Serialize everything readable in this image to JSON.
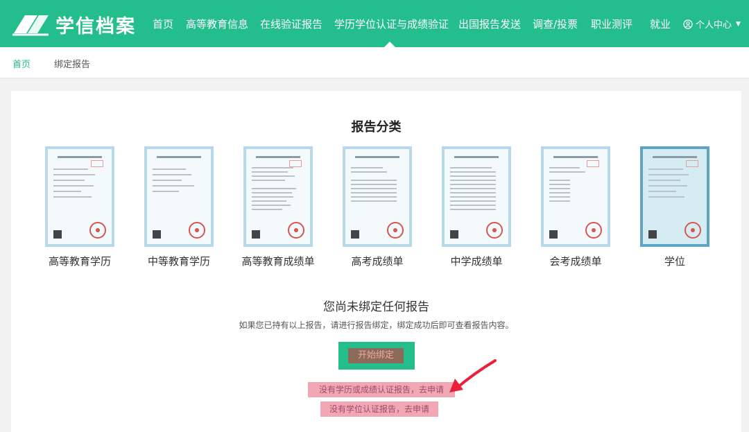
{
  "header": {
    "brand": "学信档案",
    "nav": [
      {
        "label": "首页"
      },
      {
        "label": "高等教育信息"
      },
      {
        "label": "在线验证报告"
      },
      {
        "label": "学历学位认证与成绩验证"
      },
      {
        "label": "出国报告发送"
      },
      {
        "label": "调查/投票"
      },
      {
        "label": "职业测评"
      },
      {
        "label": "就业"
      }
    ],
    "user_menu": "个人中心"
  },
  "breadcrumb": {
    "home": "首页",
    "current": "绑定报告"
  },
  "main": {
    "section_title": "报告分类",
    "reports": [
      {
        "label": "高等教育学历"
      },
      {
        "label": "中等教育学历"
      },
      {
        "label": "高等教育成绩单"
      },
      {
        "label": "高考成绩单"
      },
      {
        "label": "中学成绩单"
      },
      {
        "label": "会考成绩单"
      },
      {
        "label": "学位"
      }
    ],
    "empty_title": "您尚未绑定任何报告",
    "empty_desc": "如果您已持有以上报告，请进行报告绑定，绑定成功后即可查看报告内容。",
    "bind_button": "开始绑定",
    "apply_links": [
      "没有学历或成绩认证报告，去申请",
      "没有学位认证报告，去申请"
    ]
  },
  "colors": {
    "brand_green": "#24be8c",
    "annotation_arrow": "#e8203a",
    "highlight_pink": "#f1a7b4"
  }
}
